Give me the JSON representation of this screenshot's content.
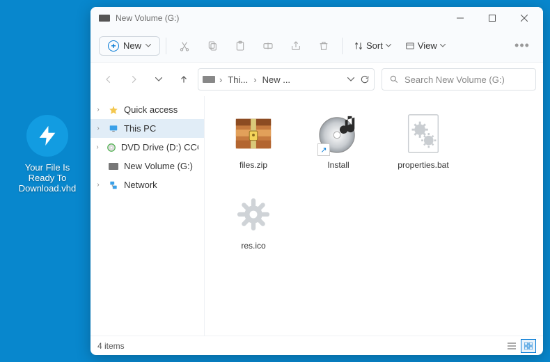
{
  "desktop": {
    "file_label": "Your File Is Ready To Download.vhd"
  },
  "window": {
    "title": "New Volume (G:)"
  },
  "toolbar": {
    "new_label": "New",
    "sort_label": "Sort",
    "view_label": "View"
  },
  "breadcrumb": {
    "crumb1": "Thi...",
    "crumb2": "New ..."
  },
  "search": {
    "placeholder": "Search New Volume (G:)"
  },
  "sidebar": {
    "items": [
      {
        "label": "Quick access"
      },
      {
        "label": "This PC"
      },
      {
        "label": "DVD Drive (D:) CCCC"
      },
      {
        "label": "New Volume (G:)"
      },
      {
        "label": "Network"
      }
    ]
  },
  "files": {
    "items": [
      {
        "label": "files.zip"
      },
      {
        "label": "Install"
      },
      {
        "label": "properties.bat"
      },
      {
        "label": "res.ico"
      }
    ]
  },
  "status": {
    "count_label": "4 items"
  }
}
